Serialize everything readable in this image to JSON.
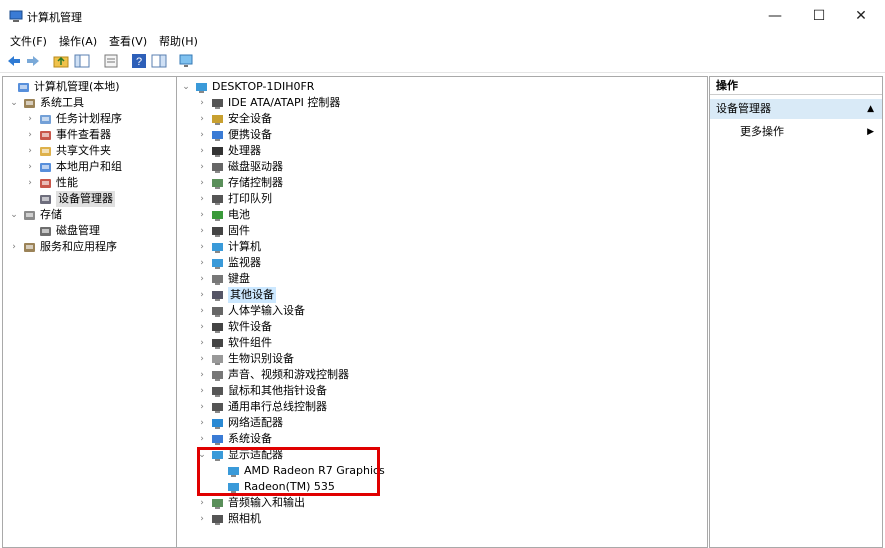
{
  "window": {
    "title": "计算机管理",
    "minimize": "—",
    "maximize": "☐",
    "close": "✕"
  },
  "menu": [
    "文件(F)",
    "操作(A)",
    "查看(V)",
    "帮助(H)"
  ],
  "toolbar": [
    "back-arrow-icon",
    "forward-arrow-icon",
    "folder-up-icon",
    "show-hide-tree-icon",
    "properties-icon",
    "help-icon",
    "view-icon",
    "monitor-icon"
  ],
  "left_tree": [
    {
      "label": "计算机管理(本地)",
      "icon": "computer-management-icon"
    },
    {
      "label": "系统工具",
      "icon": "tools-icon"
    },
    {
      "label": "任务计划程序",
      "icon": "clock-icon"
    },
    {
      "label": "事件查看器",
      "icon": "event-viewer-icon"
    },
    {
      "label": "共享文件夹",
      "icon": "shared-folder-icon"
    },
    {
      "label": "本地用户和组",
      "icon": "users-icon"
    },
    {
      "label": "性能",
      "icon": "performance-icon"
    },
    {
      "label": "设备管理器",
      "icon": "device-manager-icon"
    },
    {
      "label": "存储",
      "icon": "storage-icon"
    },
    {
      "label": "磁盘管理",
      "icon": "disk-management-icon"
    },
    {
      "label": "服务和应用程序",
      "icon": "services-icon"
    }
  ],
  "device_tree": {
    "root": "DESKTOP-1DIH0FR",
    "categories": [
      "IDE ATA/ATAPI 控制器",
      "安全设备",
      "便携设备",
      "处理器",
      "磁盘驱动器",
      "存储控制器",
      "打印队列",
      "电池",
      "固件",
      "计算机",
      "监视器",
      "键盘",
      "其他设备",
      "人体学输入设备",
      "软件设备",
      "软件组件",
      "生物识别设备",
      "声音、视频和游戏控制器",
      "鼠标和其他指针设备",
      "通用串行总线控制器",
      "网络适配器",
      "系统设备",
      "显示适配器"
    ],
    "display_adapters": [
      "AMD Radeon R7 Graphics",
      "Radeon(TM) 535"
    ],
    "after": [
      "音频输入和输出",
      "照相机"
    ]
  },
  "actions": {
    "header": "操作",
    "group": "设备管理器",
    "more": "更多操作"
  },
  "colors": {
    "highlight_box": "#e00000",
    "selection": "#cce8ff",
    "action_group_bg": "#d9eaf7"
  }
}
